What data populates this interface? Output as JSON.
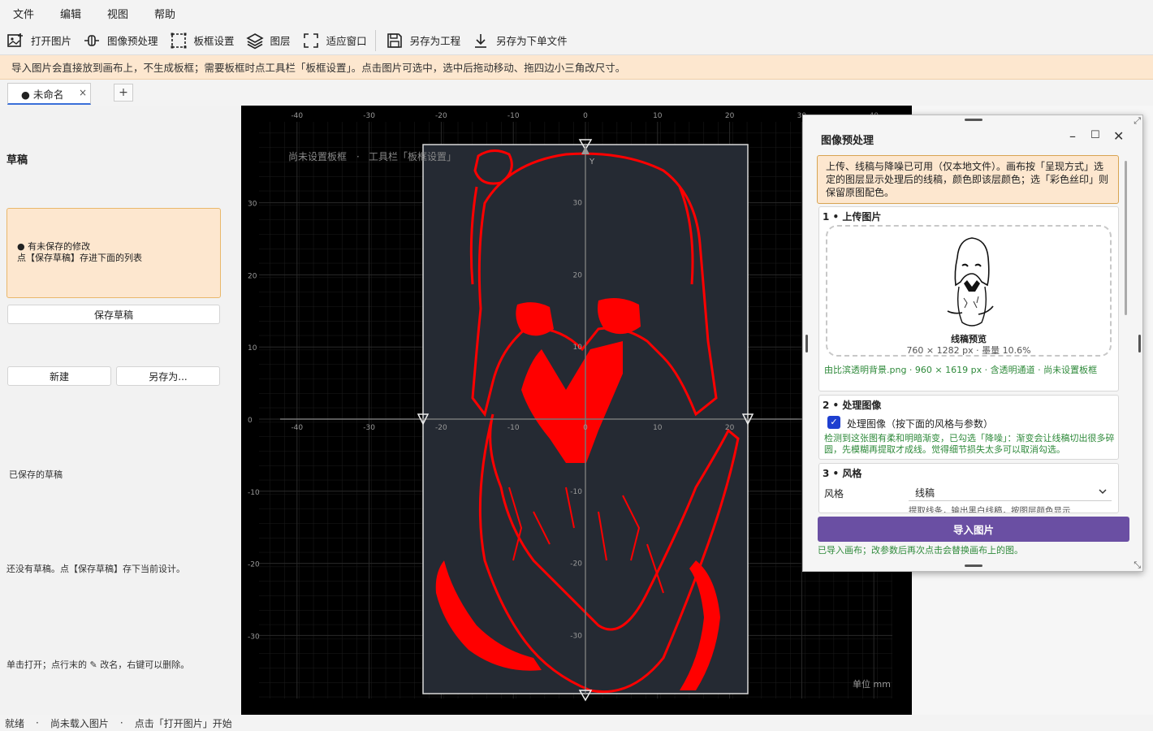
{
  "menu": [
    "文件",
    "编辑",
    "视图",
    "帮助"
  ],
  "toolbar": [
    {
      "label": "打开图片",
      "icon": "open-image-icon"
    },
    {
      "label": "图像预处理",
      "icon": "preprocess-icon"
    },
    {
      "label": "板框设置",
      "icon": "frame-settings-icon"
    },
    {
      "label": "图层",
      "icon": "layers-icon"
    },
    {
      "label": "适应窗口",
      "icon": "fit-window-icon"
    },
    {
      "label": "另存为工程",
      "icon": "save-project-icon"
    },
    {
      "label": "另存为下单文件",
      "icon": "export-order-icon"
    }
  ],
  "notice": "导入图片会直接放到画布上，不生成板框；需要板框时点工具栏「板框设置」。点击图片可选中，选中后拖动移动、拖四边小三角改尺寸。",
  "tab": {
    "label": "● 未命名",
    "add": "+",
    "close": "×"
  },
  "left": {
    "heading": "草稿",
    "unsaved_line1": "● 有未保存的修改",
    "unsaved_line2": "点【保存草稿】存进下面的列表",
    "save_draft": "保存草稿",
    "new": "新建",
    "save_as": "另存为...",
    "saved_label": "已保存的草稿",
    "empty_hint": "还没有草稿。点【保存草稿】存下当前设计。",
    "usage_hint": "单击打开；点行末的 ✎ 改名，右键可以删除。"
  },
  "canvas": {
    "frame_hint": "尚未设置板框",
    "frame_hint_sep": "·",
    "frame_hint2": "工具栏「板框设置」",
    "y_label": "Y",
    "unit": "单位 mm",
    "top_ticks": [
      "-40",
      "-30",
      "-20",
      "-10",
      "0",
      "10",
      "20",
      "30",
      "40"
    ],
    "mid_ticks": [
      "-40",
      "-30",
      "-20",
      "-10",
      "0",
      "10",
      "20"
    ],
    "left_ticks": [
      "30",
      "20",
      "10",
      "0",
      "-10",
      "-20",
      "-30"
    ],
    "axis_ticks": [
      "30",
      "20",
      "10",
      "-10",
      "-20",
      "-30"
    ]
  },
  "panel": {
    "title": "图像预处理",
    "note": "上传、线稿与降噪已可用（仅本地文件）。画布按「呈现方式」选定的图层显示处理后的线稿，颜色即该层颜色；选「彩色丝印」则保留原图配色。",
    "s1_title": "1 • 上传图片",
    "preview_label": "线稿预览",
    "preview_info": "760 × 1282 px  ·  墨量 10.6%",
    "file_info": "由比滨透明背景.png  ·  960 × 1619 px  ·  含透明通道  ·  尚未设置板框",
    "s2_title": "2 • 处理图像",
    "process_check": "处理图像（按下面的风格与参数）",
    "process_note": "检测到这张图有柔和明暗渐变，已勾选「降噪」：渐变会让线稿切出很多碎圆，先模糊再提取才成线。觉得细节损失太多可以取消勾选。",
    "s3_title": "3 • 风格",
    "style_label": "风格",
    "style_value": "线稿",
    "style_note": "提取线条，输出黑白线稿，按图层颜色显示",
    "import": "导入图片",
    "import_status": "已导入画布；改参数后再次点击会替换画布上的图。"
  },
  "status": {
    "ready": "就绪",
    "sep": "·",
    "no_image": "尚未载入图片",
    "hint": "点击「打开图片」开始"
  },
  "colors": {
    "accent": "#6a4fa3",
    "notice_bg": "#fde7cf",
    "line_red": "#ff0000",
    "check_blue": "#1e3fd0"
  }
}
